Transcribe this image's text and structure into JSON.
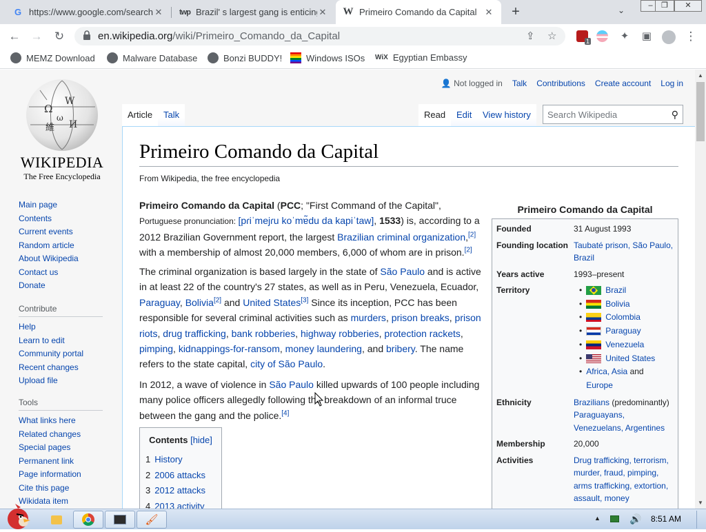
{
  "browser": {
    "tabs": [
      {
        "title": "https://www.google.com/search",
        "favicon": "google-icon",
        "active": false
      },
      {
        "title": "Brazil' s largest gang is enticing",
        "favicon": "tvp-icon",
        "active": false
      },
      {
        "title": "Primeiro Comando da Capital",
        "favicon": "wikipedia-icon",
        "active": true
      }
    ],
    "new_tab": "+",
    "url_domain": "en.wikipedia.org",
    "url_path": "/wiki/Primeiro_Comando_da_Capital",
    "extension_badge": "1",
    "bookmarks": [
      "MEMZ Download",
      "Malware Database",
      "Bonzi BUDDY!",
      "Windows ISOs",
      "Egyptian Embassy"
    ]
  },
  "wiki": {
    "wordmark": "WIKIPEDIA",
    "tagline": "The Free Encyclopedia",
    "nav": [
      "Main page",
      "Contents",
      "Current events",
      "Random article",
      "About Wikipedia",
      "Contact us",
      "Donate"
    ],
    "contribute_head": "Contribute",
    "contribute": [
      "Help",
      "Learn to edit",
      "Community portal",
      "Recent changes",
      "Upload file"
    ],
    "tools_head": "Tools",
    "tools": [
      "What links here",
      "Related changes",
      "Special pages",
      "Permanent link",
      "Page information",
      "Cite this page",
      "Wikidata item"
    ],
    "personal": {
      "not_logged": "Not logged in",
      "talk": "Talk",
      "contributions": "Contributions",
      "create": "Create account",
      "login": "Log in"
    },
    "tabs": {
      "article": "Article",
      "talk": "Talk",
      "read": "Read",
      "edit": "Edit",
      "history": "View history"
    },
    "search_placeholder": "Search Wikipedia",
    "title": "Primeiro Comando da Capital",
    "from": "From Wikipedia, the free encyclopedia",
    "toc": {
      "title": "Contents",
      "hide": "[hide]",
      "items": [
        {
          "n": "1",
          "label": "History"
        },
        {
          "n": "2",
          "label": "2006 attacks"
        },
        {
          "n": "3",
          "label": "2012 attacks"
        },
        {
          "n": "4",
          "label": "2013 activity"
        }
      ]
    },
    "infobox": {
      "title": "Primeiro Comando da Capital",
      "founded_k": "Founded",
      "founded_v": "31 August 1993",
      "location_k": "Founding location",
      "location_v": "Taubaté prison, São Paulo, Brazil",
      "years_k": "Years active",
      "years_v": "1993–present",
      "territory_k": "Territory",
      "territory": [
        "Brazil",
        "Bolivia",
        "Colombia",
        "Paraguay",
        "Venezuela",
        "United States"
      ],
      "territory_extra_a": "Africa, Asia",
      "territory_extra_and": " and",
      "territory_extra_b": "Europe",
      "ethnicity_k": "Ethnicity",
      "ethnicity_a": "Brazilians",
      "ethnicity_b": " (predominantly)",
      "ethnicity_c": "Paraguayans, Venezuelans, Argentines",
      "membership_k": "Membership",
      "membership_v": "20,000",
      "activities_k": "Activities",
      "activities_v": "Drug trafficking, terrorism, murder, fraud, pimping, arms trafficking, extortion, assault, money"
    }
  },
  "taskbar": {
    "clock": "8:51 AM"
  }
}
